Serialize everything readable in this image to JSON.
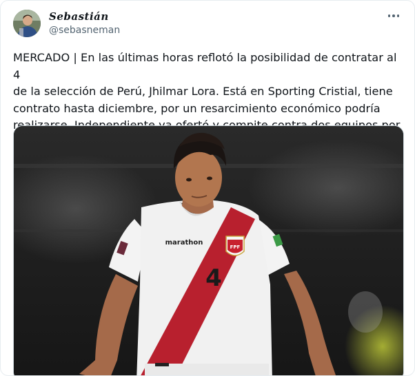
{
  "author": {
    "display_name": "Sebastián",
    "handle": "@sebasneman",
    "avatar_icon": "user-avatar-photo"
  },
  "menu_icon": "more-horizontal-icon",
  "tweet": {
    "text": "MERCADO | En las últimas horas reflotó la posibilidad de contratar al 4\nde la selección de Perú, Jhilmar Lora. Está en Sporting Cristial, tiene\ncontrato hasta diciembre, por un resarcimiento económico podría\nrealizarse. Independiente ya ofertó y compite contra dos equipos por él."
  },
  "media": {
    "jersey_brand": "marathon",
    "jersey_number": "4",
    "crest_text": "FPF"
  },
  "colors": {
    "handle_gray": "#536471",
    "text": "#0f1419",
    "peru_red": "#b8202e"
  }
}
